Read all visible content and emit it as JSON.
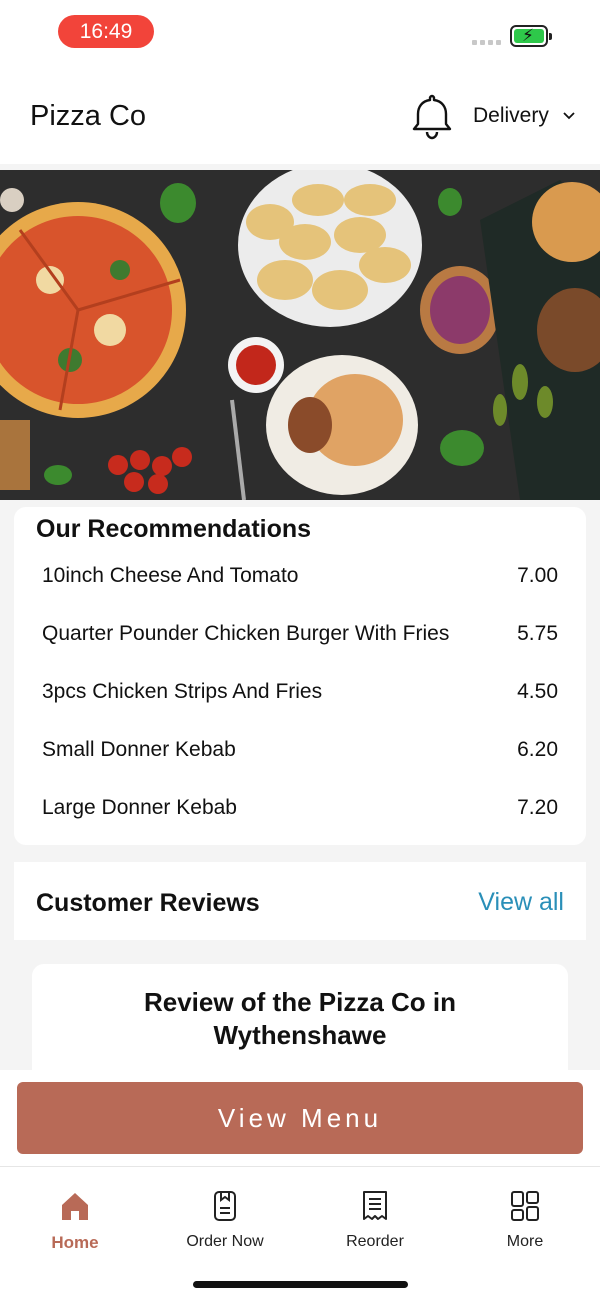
{
  "status_bar": {
    "time": "16:49"
  },
  "header": {
    "brand": "Pizza Co",
    "order_mode": "Delivery"
  },
  "recommendations": {
    "title": "Our Recommendations",
    "items": [
      {
        "name": "10inch Cheese And Tomato",
        "price": "7.00"
      },
      {
        "name": "Quarter Pounder Chicken Burger With Fries",
        "price": "5.75"
      },
      {
        "name": "3pcs Chicken Strips And Fries",
        "price": "4.50"
      },
      {
        "name": "Small Donner Kebab",
        "price": "6.20"
      },
      {
        "name": "Large Donner Kebab",
        "price": "7.20"
      }
    ]
  },
  "reviews": {
    "title": "Customer Reviews",
    "view_all": "View all",
    "card_title": "Review of the Pizza Co in Wythenshawe"
  },
  "cta": {
    "label": "View Menu"
  },
  "tabs": [
    {
      "label": "Home",
      "icon": "home-icon",
      "active": true
    },
    {
      "label": "Order Now",
      "icon": "order-icon",
      "active": false
    },
    {
      "label": "Reorder",
      "icon": "receipt-icon",
      "active": false
    },
    {
      "label": "More",
      "icon": "grid-icon",
      "active": false
    }
  ],
  "colors": {
    "accent": "#b86a57",
    "link": "#2a8fb8",
    "time_pill": "#f2443a",
    "battery": "#2ec84a"
  }
}
